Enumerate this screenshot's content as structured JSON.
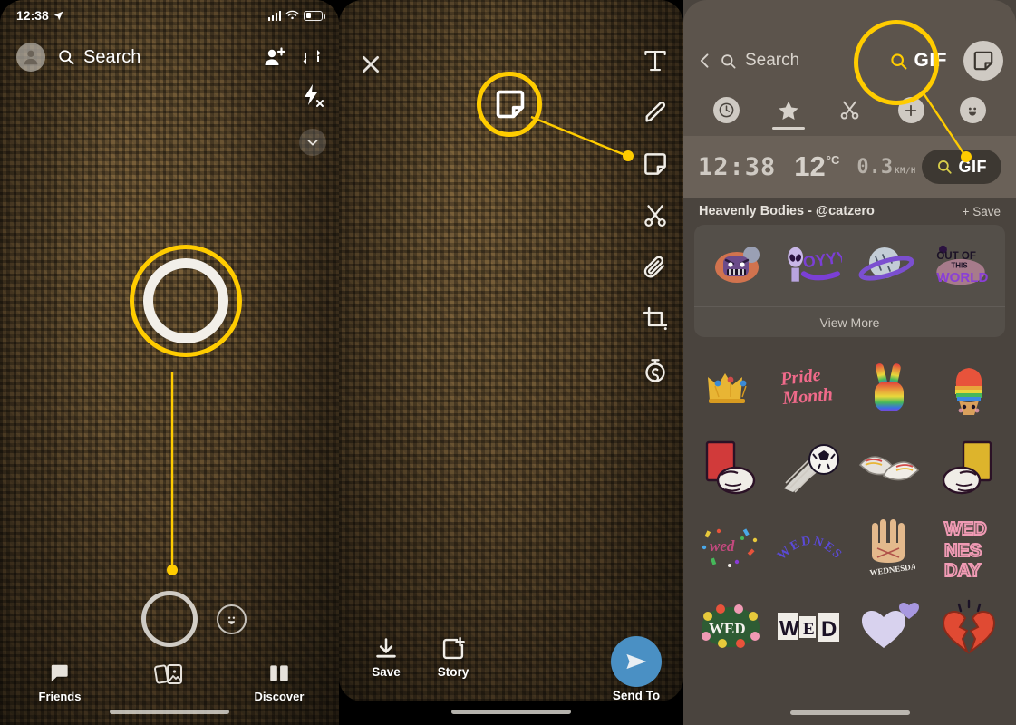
{
  "panel1": {
    "status": {
      "time": "12:38",
      "location_icon": "location-arrow-icon",
      "signal_icon": "cellular-signal-icon",
      "wifi_icon": "wifi-icon",
      "battery_icon": "battery-icon"
    },
    "profile_icon": "profile-avatar-icon",
    "search_label": "Search",
    "search_icon": "search-icon",
    "add_friend_icon": "add-friend-icon",
    "flip_camera_icon": "flip-camera-icon",
    "flash_off_icon": "flash-off-icon",
    "chevron_down_icon": "chevron-down-icon",
    "shutter_icon": "shutter-button",
    "lens_icon": "lens-smiley-icon",
    "nav": [
      {
        "label": "Friends",
        "icon": "chat-bubble-icon"
      },
      {
        "label": "",
        "icon": "stories-cards-icon"
      },
      {
        "label": "Discover",
        "icon": "discover-icon"
      }
    ]
  },
  "panel2": {
    "close_icon": "close-x-icon",
    "tools": [
      {
        "name": "text-tool",
        "icon": "text-T-icon"
      },
      {
        "name": "draw-tool",
        "icon": "pencil-icon"
      },
      {
        "name": "sticker-tool",
        "icon": "sticker-icon"
      },
      {
        "name": "scissors-tool",
        "icon": "scissors-icon"
      },
      {
        "name": "attach-tool",
        "icon": "paperclip-icon"
      },
      {
        "name": "crop-tool",
        "icon": "crop-icon"
      },
      {
        "name": "timer-tool",
        "icon": "timer-icon"
      }
    ],
    "save_label": "Save",
    "save_icon": "download-icon",
    "story_label": "Story",
    "story_icon": "add-to-story-icon",
    "send_label": "Send To",
    "send_icon": "send-arrow-icon",
    "send_color": "#4a90c4"
  },
  "panel3": {
    "back_icon": "back-chevron-icon",
    "search_label": "Search",
    "search_icon": "search-icon",
    "gif_header_label": "GIF",
    "sticker_button_icon": "sticker-icon",
    "tabs": [
      {
        "name": "recent",
        "icon": "clock-icon",
        "active": false
      },
      {
        "name": "favorites",
        "icon": "star-icon",
        "active": true
      },
      {
        "name": "cutouts",
        "icon": "scissors-icon",
        "active": false
      },
      {
        "name": "create",
        "icon": "plus-icon",
        "active": false
      },
      {
        "name": "emoji",
        "icon": "smiley-icon",
        "active": false
      }
    ],
    "widgets": {
      "time": "12:38",
      "temperature": "12",
      "temperature_unit": "°C",
      "speed": "0.3",
      "speed_unit": "KM/H",
      "gif_label": "GIF"
    },
    "pack": {
      "title": "Heavenly Bodies - @catzero",
      "save_label": "+ Save",
      "view_more_label": "View More",
      "stickers": [
        {
          "name": "angry-monster-sticker",
          "text": ""
        },
        {
          "name": "alien-oyyyy-sticker",
          "text": "OYYYY"
        },
        {
          "name": "saturn-planet-sticker",
          "text": ""
        },
        {
          "name": "out-of-this-world-sticker",
          "text": "OUT OF THIS WORLD"
        }
      ]
    },
    "grid": [
      {
        "name": "crown-sticker",
        "text": ""
      },
      {
        "name": "pride-month-sticker",
        "text": "Pride Month"
      },
      {
        "name": "rainbow-peace-hand-sticker",
        "text": ""
      },
      {
        "name": "rainbow-ice-cream-sticker",
        "text": ""
      },
      {
        "name": "red-card-sticker",
        "text": ""
      },
      {
        "name": "soccer-ball-sticker",
        "text": ""
      },
      {
        "name": "soccer-cleats-sticker",
        "text": ""
      },
      {
        "name": "yellow-card-sticker",
        "text": ""
      },
      {
        "name": "confetti-sticker",
        "text": ""
      },
      {
        "name": "wednesday-arc-sticker",
        "text": "WEDNESDAY"
      },
      {
        "name": "wednesday-hand-sticker",
        "text": "WEDNESDAY"
      },
      {
        "name": "wednesday-block-sticker",
        "text": "WED NES DAY"
      },
      {
        "name": "wed-flowers-sticker",
        "text": "WED"
      },
      {
        "name": "wed-letters-sticker",
        "text": "WED"
      },
      {
        "name": "purple-hearts-sticker",
        "text": ""
      },
      {
        "name": "broken-heart-sticker",
        "text": ""
      }
    ]
  },
  "annotations": {
    "color": "#ffcc00",
    "items": [
      {
        "name": "shutter-button-highlight",
        "panel": 1
      },
      {
        "name": "sticker-tool-highlight",
        "panel": 2
      },
      {
        "name": "gif-search-highlight",
        "panel": 3
      }
    ]
  }
}
